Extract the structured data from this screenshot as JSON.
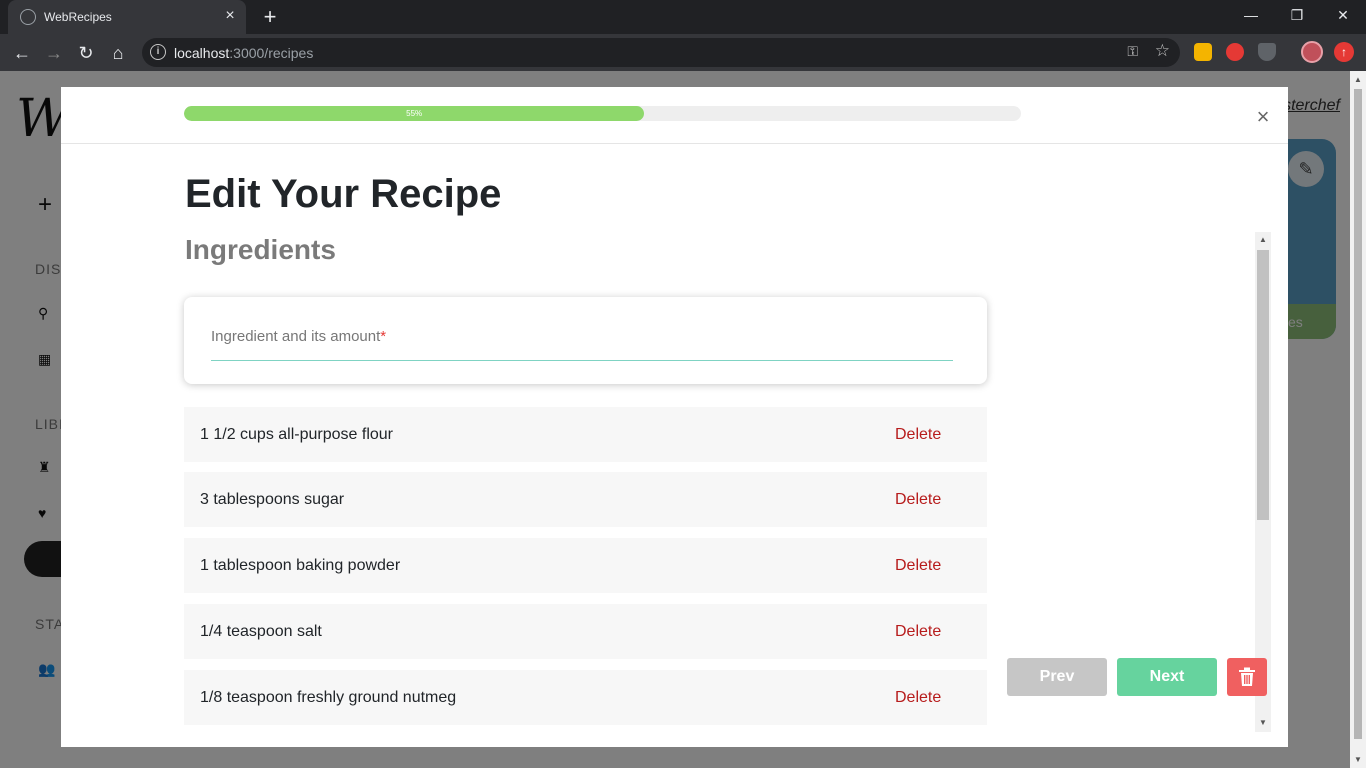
{
  "browser": {
    "tab_title": "WebRecipes",
    "url_host": "localhost",
    "url_path": ":3000/recipes"
  },
  "background_page": {
    "logo": "We",
    "section_discover": "DIS",
    "section_library": "LIBI",
    "section_stats": "STA",
    "user_link": "sterchef",
    "card_label": "es"
  },
  "modal": {
    "progress_value": 55,
    "progress_label": "55%",
    "title": "Edit Your Recipe",
    "subtitle": "Ingredients",
    "input_label": "Ingredient and its amount",
    "input_required_mark": "*",
    "delete_label": "Delete",
    "ingredients": [
      "1 1/2 cups all-purpose flour",
      "3 tablespoons sugar",
      "1 tablespoon baking powder",
      "1/4 teaspoon salt",
      "1/8 teaspoon freshly ground nutmeg"
    ],
    "prev_label": "Prev",
    "next_label": "Next"
  },
  "colors": {
    "progress_fill": "#8ed86b",
    "next_button": "#66d39e",
    "delete_text": "#b71c1c",
    "trash_button": "#f06060"
  }
}
